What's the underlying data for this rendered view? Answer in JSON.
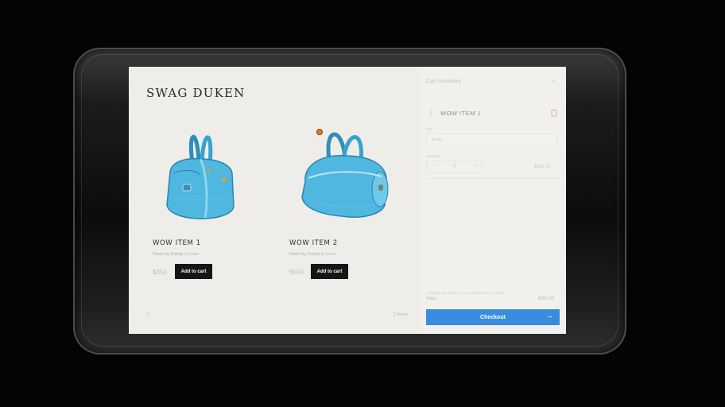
{
  "store": {
    "title": "SWAG DUKEN",
    "products": [
      {
        "name": "WOW ITEM 1",
        "subtitle": "Made by Daddy in Love",
        "price": "$350",
        "add_label": "Add to cart"
      },
      {
        "name": "WOW ITEM 2",
        "subtitle": "Made by Daddy in Love",
        "price": "$550",
        "add_label": "Add to cart"
      }
    ],
    "pager_prev": "<",
    "item_count": "2 items"
  },
  "cart": {
    "title": "Cart summary",
    "close": "×",
    "item_name": "WOW ITEM 1",
    "size_label": "Size",
    "size_value": "Small",
    "quantity_label": "Quantity",
    "qty_minus": "−",
    "qty_value": "1",
    "qty_plus": "+",
    "line_price": "$350.00",
    "shipping_note": "Shipping and taxes will be calculated at checkout",
    "total_label": "Total",
    "total_value": "$350.00",
    "checkout_label": "Checkout",
    "checkout_arrow": "→"
  },
  "colors": {
    "accent": "#3a8dde",
    "bag": "#4fb7e0",
    "button_dark": "#151515",
    "hotspot": "#e07a1f"
  },
  "icons": [
    "handbag-image",
    "drag-handle-icon",
    "trash-icon",
    "close-icon",
    "chevron-down-icon",
    "arrow-right-icon"
  ]
}
